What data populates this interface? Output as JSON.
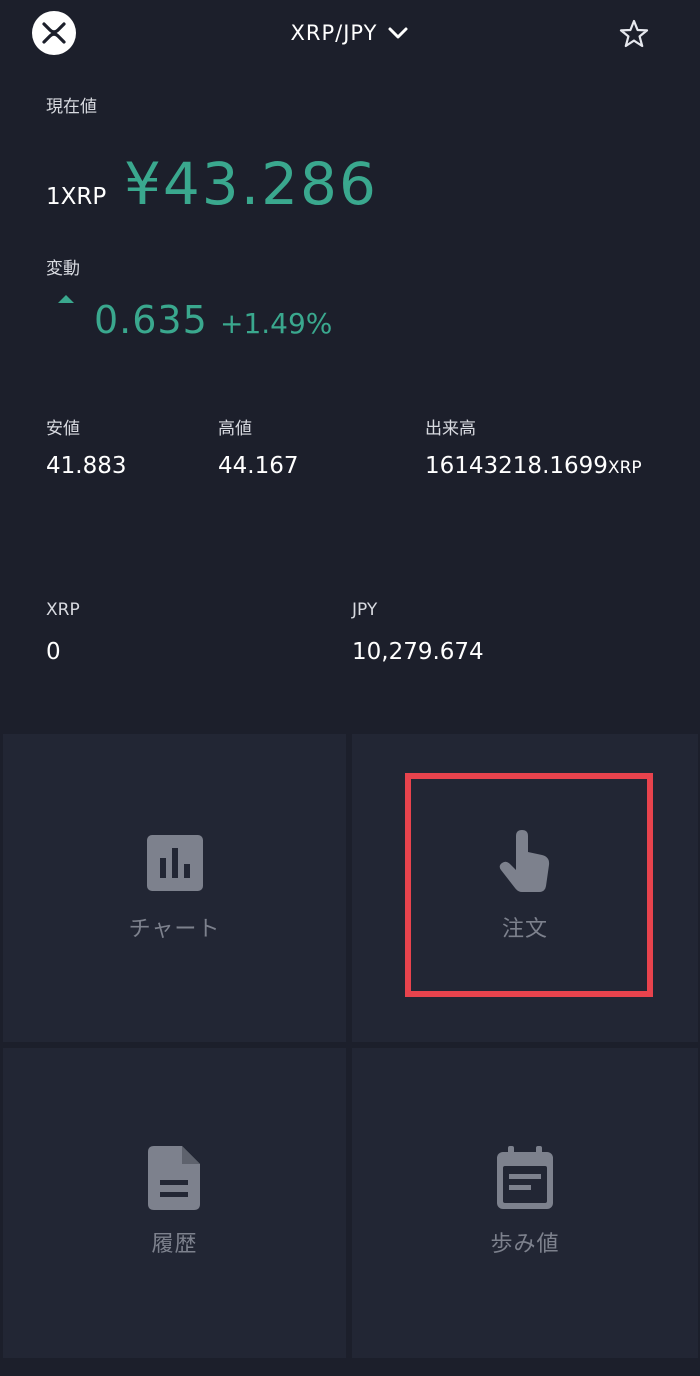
{
  "header": {
    "pair": "XRP/JPY",
    "logo_icon": "xrp-logo-icon",
    "dropdown_icon": "chevron-down-icon",
    "favorite_icon": "star-outline-icon"
  },
  "price": {
    "current_label": "現在値",
    "unit": "1XRP",
    "value": "¥43.286",
    "change_label": "変動",
    "change_direction": "up",
    "change_value": "0.635",
    "change_percent": "+1.49%",
    "color_up": "#3aa88e"
  },
  "stats": {
    "low_label": "安値",
    "low_value": "41.883",
    "high_label": "高値",
    "high_value": "44.167",
    "volume_label": "出来高",
    "volume_value": "16143218.1699",
    "volume_unit": "XRP"
  },
  "balances": {
    "xrp_label": "XRP",
    "xrp_value": "0",
    "jpy_label": "JPY",
    "jpy_value": "10,279.674"
  },
  "menu": {
    "chart": {
      "label": "チャート",
      "icon": "bar-chart-icon"
    },
    "order": {
      "label": "注文",
      "icon": "tap-hand-icon"
    },
    "history": {
      "label": "履歴",
      "icon": "document-icon"
    },
    "trades": {
      "label": "歩み値",
      "icon": "calendar-icon"
    },
    "highlight_color": "#e8434d"
  }
}
